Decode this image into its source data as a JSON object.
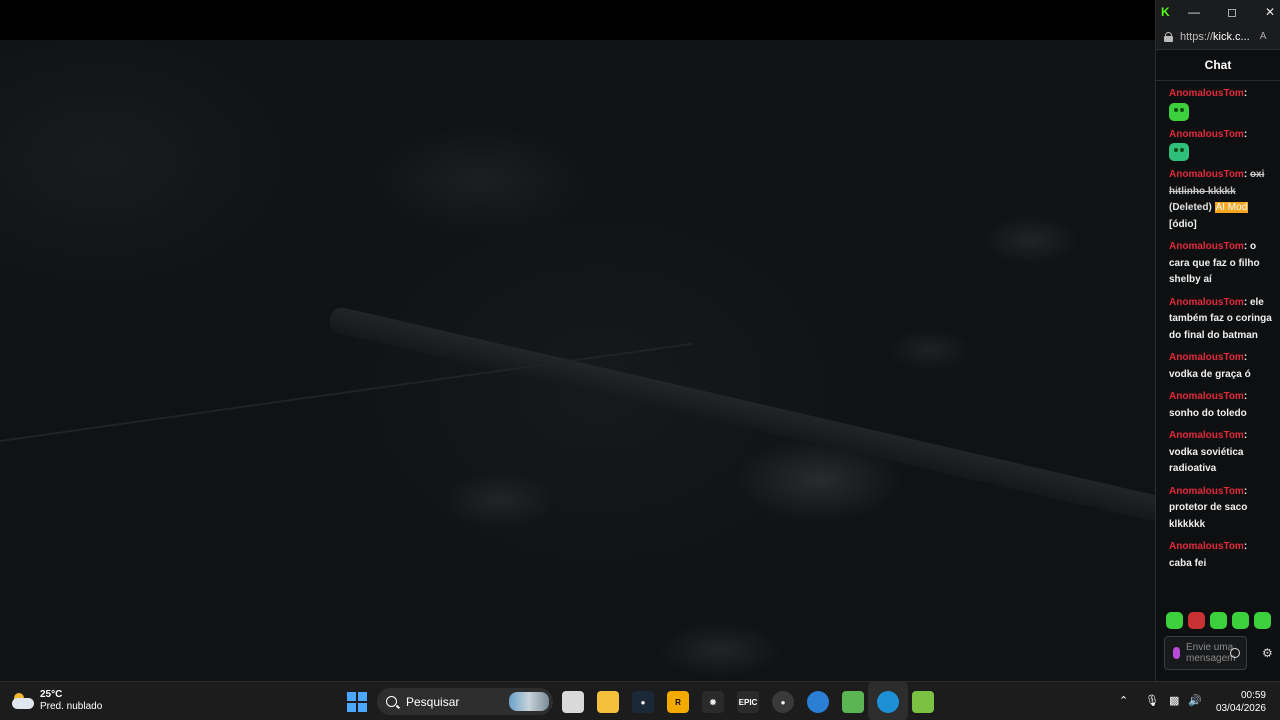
{
  "browser": {
    "url_prefix": "https://",
    "url_domain": "kick.c...",
    "read_aloud_label": "A"
  },
  "chat": {
    "header": "Chat",
    "messages": [
      {
        "user": "AnomalousTom",
        "sep": ":",
        "text": "",
        "emote": "green-emote"
      },
      {
        "user": "AnomalousTom",
        "sep": ":",
        "text": "",
        "emote": "green-emote-2"
      },
      {
        "user": "AnomalousTom",
        "sep": ":",
        "deleted_text": "oxi hitlinho kkkkk",
        "deleted_tag": "(Deleted)",
        "badge": "AI Mod",
        "reason": "[ódio]"
      },
      {
        "user": "AnomalousTom",
        "sep": ":",
        "text": "o cara que faz o filho shelby aí"
      },
      {
        "user": "AnomalousTom",
        "sep": ":",
        "text": "ele também faz o coringa do final do batman"
      },
      {
        "user": "AnomalousTom",
        "sep": ":",
        "text": "vodka de graça ó"
      },
      {
        "user": "AnomalousTom",
        "sep": ":",
        "text": "sonho do toledo"
      },
      {
        "user": "AnomalousTom",
        "sep": ":",
        "text": "vodka soviética radioativa"
      },
      {
        "user": "AnomalousTom",
        "sep": ":",
        "text": "protetor de saco klkkkkk"
      },
      {
        "user": "AnomalousTom",
        "sep": ":",
        "text": "caba fei"
      }
    ],
    "input_placeholder": "Envie uma mensagem"
  },
  "taskbar": {
    "weather_temp": "25°C",
    "weather_desc": "Pred. nublado",
    "search_placeholder": "Pesquisar",
    "apps": [
      "task-view",
      "file-explorer",
      "steam",
      "rockstar",
      "unknown-app",
      "epic-games",
      "chrome-like",
      "browser",
      "android-app",
      "edge",
      "bluestacks"
    ],
    "epic_label": "EPIC",
    "time": "00:59",
    "date": "03/04/2026"
  },
  "colors": {
    "username": "#e22b3a",
    "kick_green": "#53fc18",
    "ai_badge": "#f5a623"
  }
}
